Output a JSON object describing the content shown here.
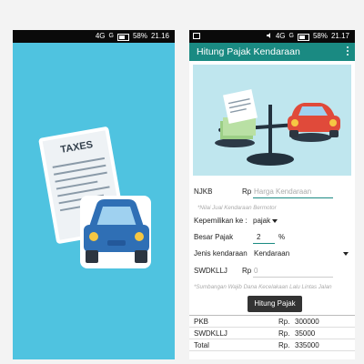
{
  "left_screen": {
    "status": {
      "net": "4G",
      "sig": "G",
      "battery": "58%",
      "time": "21.16"
    },
    "splash": {
      "document_title": "TAXES"
    }
  },
  "right_screen": {
    "status": {
      "net": "4G",
      "sig": "G",
      "battery": "58%",
      "time": "21.17"
    },
    "app_title": "Hitung Pajak Kendaraan",
    "form": {
      "njkb_label": "NJKB",
      "currency": "Rp",
      "njkb_placeholder": "Harga Kendaraan",
      "njkb_hint": "*Nilai Jual Kendaraan Bermotor",
      "ownership_label": "Kepemilikan ke :",
      "ownership_value": "pajak",
      "tax_rate_label": "Besar Pajak",
      "tax_rate_value": "2",
      "percent": "%",
      "vehicle_type_label": "Jenis kendaraan",
      "vehicle_type_value": "Kendaraan",
      "swdkllj_label": "SWDKLLJ",
      "swdkllj_currency": "Rp",
      "swdkllj_value": "0",
      "swdkllj_hint": "*Sumbangan Wajib Dana Kecelakaan Lalu Lintas Jalan",
      "calc_button": "Hitung Pajak"
    },
    "results": [
      {
        "label": "PKB",
        "currency": "Rp.",
        "value": "300000"
      },
      {
        "label": "SWDKLLJ",
        "currency": "Rp.",
        "value": "35000"
      },
      {
        "label": "Total",
        "currency": "Rp.",
        "value": "335000"
      }
    ]
  },
  "colors": {
    "splash_bg": "#4fc3e0",
    "appbar": "#1a8a82",
    "car": "#2f6fb5",
    "car_red": "#e04a3a"
  }
}
